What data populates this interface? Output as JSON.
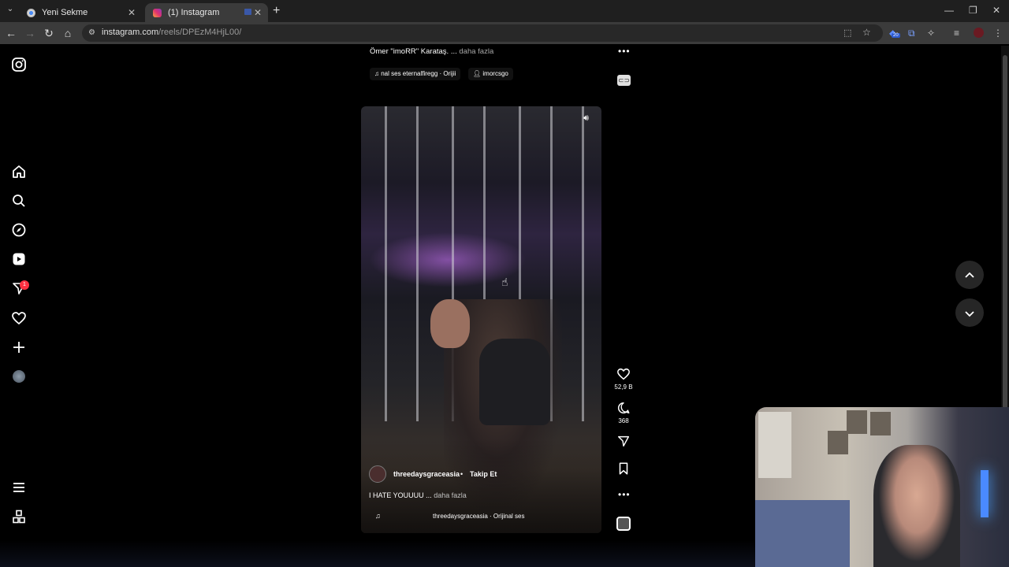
{
  "browser": {
    "tabs": [
      {
        "label": "Yeni Sekme",
        "active": false
      },
      {
        "label": "(1) Instagram",
        "active": true
      }
    ],
    "url_host": "instagram.com",
    "url_path": "/reels/DPEzM4HjL00/",
    "extension_badge": "20"
  },
  "sidebar": {
    "notification_count": "1"
  },
  "previous_post": {
    "caption": "Ömer \"imoRR\" Karataş. ...",
    "more_label": "daha fazla",
    "audio_chip": "nal ses   eternalfiregg · Orijii",
    "user_chip": "imorcsgo"
  },
  "reel": {
    "author": "threedaysgraceasia",
    "separator": "•",
    "follow_label": "Takip Et",
    "caption": "I HATE YOUUUU ...",
    "more_label": "daha fazla",
    "audio": "threedaysgraceasia · Orijinal ses",
    "likes": "52,9 B",
    "comments": "368"
  },
  "colors": {
    "background": "#000000",
    "chrome_dark": "#1f1f1f",
    "chrome_toolbar": "#3b3b3b",
    "notification_badge": "#ff3040"
  }
}
